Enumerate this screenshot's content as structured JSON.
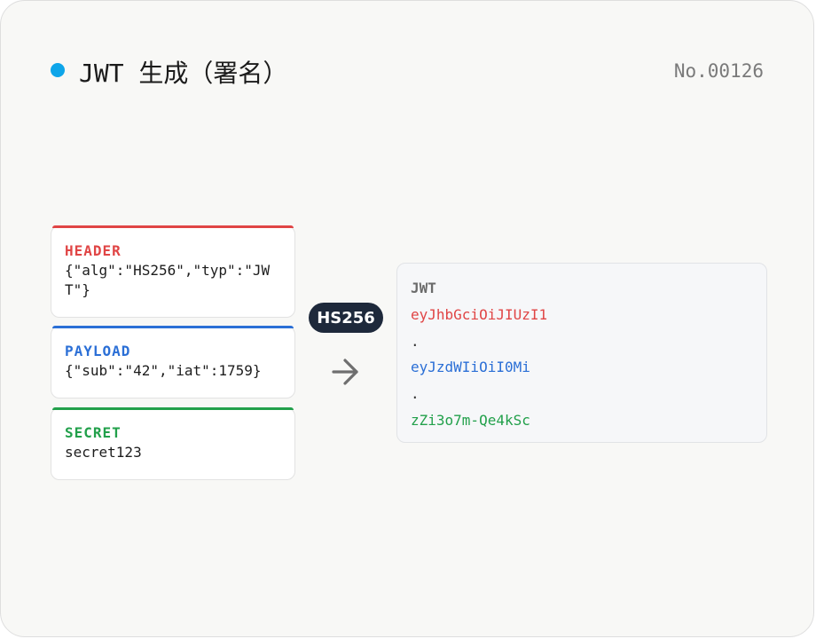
{
  "title": "JWT 生成（署名）",
  "number": "No.00126",
  "inputs": {
    "header": {
      "label": "HEADER",
      "value": "{\"alg\":\"HS256\",\"typ\":\"JWT\"}"
    },
    "payload": {
      "label": "PAYLOAD",
      "value": "{\"sub\":\"42\",\"iat\":1759}"
    },
    "secret": {
      "label": "SECRET",
      "value": "secret123"
    }
  },
  "algorithm": "HS256",
  "output": {
    "label": "JWT",
    "header_part": "eyJhbGciOiJIUzI1",
    "separator": ".",
    "payload_part": "eyJzdWIiOiI0Mi",
    "signature_part": "zZi3o7m-Qe4kSc"
  },
  "colors": {
    "title_dot": "#0ea5e9",
    "header": "#e04545",
    "payload": "#2b6fd6",
    "secret": "#22a04b",
    "badge": "#1e293b"
  },
  "icons": {
    "title_dot": "dot-icon",
    "arrow": "arrow-right-icon"
  }
}
